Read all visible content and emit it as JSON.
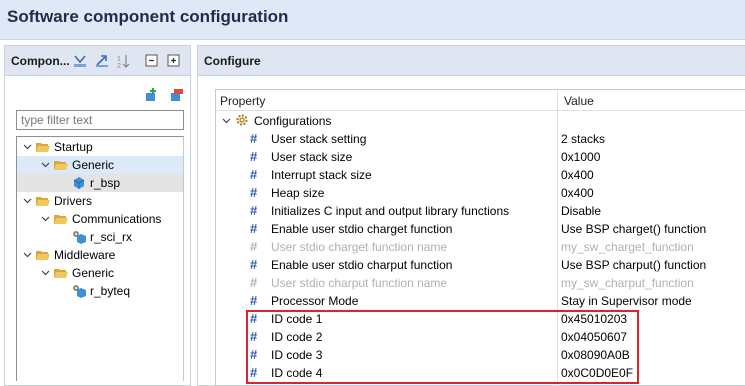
{
  "window": {
    "title": "Software component configuration"
  },
  "components_panel": {
    "title": "Compon...",
    "filter_placeholder": "type filter text",
    "tree": [
      {
        "label": "Startup",
        "level": 0,
        "expanded": true,
        "kind": "folder"
      },
      {
        "label": "Generic",
        "level": 1,
        "expanded": true,
        "kind": "folder"
      },
      {
        "label": "r_bsp",
        "level": 2,
        "kind": "component"
      },
      {
        "label": "Drivers",
        "level": 0,
        "expanded": true,
        "kind": "folder"
      },
      {
        "label": "Communications",
        "level": 1,
        "expanded": true,
        "kind": "folder"
      },
      {
        "label": "r_sci_rx",
        "level": 2,
        "kind": "component-config"
      },
      {
        "label": "Middleware",
        "level": 0,
        "expanded": true,
        "kind": "folder"
      },
      {
        "label": "Generic",
        "level": 1,
        "expanded": true,
        "kind": "folder"
      },
      {
        "label": "r_byteq",
        "level": 2,
        "kind": "component-config"
      }
    ]
  },
  "configure_panel": {
    "title": "Configure",
    "columns": {
      "property": "Property",
      "value": "Value"
    },
    "group_label": "Configurations",
    "rows": [
      {
        "property": "User stack setting",
        "value": "2 stacks",
        "disabled": false
      },
      {
        "property": "User stack size",
        "value": "0x1000",
        "disabled": false
      },
      {
        "property": "Interrupt stack size",
        "value": "0x400",
        "disabled": false
      },
      {
        "property": "Heap size",
        "value": "0x400",
        "disabled": false
      },
      {
        "property": "Initializes C input and output library functions",
        "value": "Disable",
        "disabled": false
      },
      {
        "property": "Enable user stdio charget function",
        "value": "Use BSP charget() function",
        "disabled": false
      },
      {
        "property": "User stdio charget function name",
        "value": "my_sw_charget_function",
        "disabled": true
      },
      {
        "property": "Enable user stdio charput function",
        "value": "Use BSP charput() function",
        "disabled": false
      },
      {
        "property": "User stdio charput function name",
        "value": "my_sw_charput_function",
        "disabled": true
      },
      {
        "property": "Processor Mode",
        "value": "Stay in Supervisor mode",
        "disabled": false
      },
      {
        "property": "ID code 1",
        "value": "0x45010203",
        "disabled": false
      },
      {
        "property": "ID code 2",
        "value": "0x04050607",
        "disabled": false
      },
      {
        "property": "ID code 3",
        "value": "0x08090A0B",
        "disabled": false
      },
      {
        "property": "ID code 4",
        "value": "0x0C0D0E0F",
        "disabled": false
      }
    ]
  },
  "colors": {
    "accent": "#2b5aa8",
    "highlight_box": "#d7262e",
    "folder": "#e8b94a",
    "selection": "#dbe9f8"
  }
}
